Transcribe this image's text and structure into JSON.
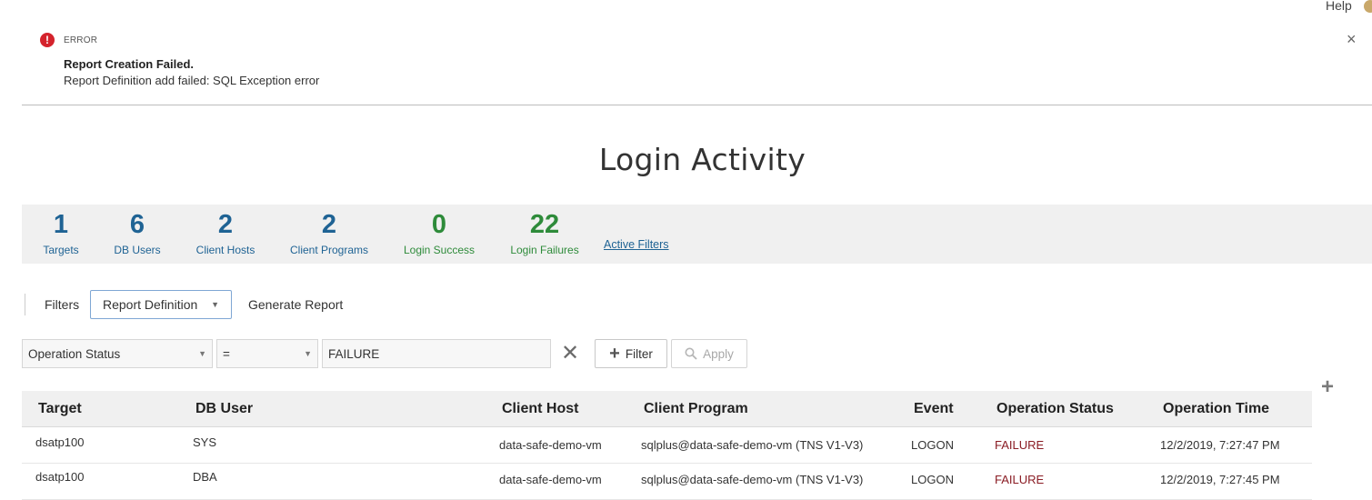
{
  "header": {
    "help_label": "Help"
  },
  "error": {
    "icon": "!",
    "label": "ERROR",
    "title": "Report Creation Failed.",
    "message": "Report Definition add failed: SQL Exception error",
    "close_glyph": "×"
  },
  "page_title": "Login Activity",
  "summary": [
    {
      "value": "1",
      "label": "Targets",
      "color": "blue"
    },
    {
      "value": "6",
      "label": "DB Users",
      "color": "blue"
    },
    {
      "value": "2",
      "label": "Client Hosts",
      "color": "blue"
    },
    {
      "value": "2",
      "label": "Client Programs",
      "color": "blue"
    },
    {
      "value": "0",
      "label": "Login Success",
      "color": "green"
    },
    {
      "value": "22",
      "label": "Login Failures",
      "color": "green"
    }
  ],
  "active_filters_label": "Active Filters",
  "toolbar": {
    "filters_label": "Filters",
    "report_definition_label": "Report Definition",
    "generate_report_label": "Generate Report"
  },
  "filter_row": {
    "field": "Operation Status",
    "operator": "=",
    "value": "FAILURE",
    "add_filter_label": "Filter",
    "apply_label": "Apply"
  },
  "table": {
    "columns": [
      "Target",
      "DB User",
      "Client Host",
      "Client Program",
      "Event",
      "Operation Status",
      "Operation Time"
    ],
    "rows": [
      {
        "target": "dsatp100",
        "db_user": "SYS",
        "client_host": "data-safe-demo-vm",
        "client_program": "sqlplus@data-safe-demo-vm (TNS V1-V3)",
        "event": "LOGON",
        "operation_status": "FAILURE",
        "operation_time": "12/2/2019, 7:27:47 PM"
      },
      {
        "target": "dsatp100",
        "db_user": "DBA",
        "client_host": "data-safe-demo-vm",
        "client_program": "sqlplus@data-safe-demo-vm (TNS V1-V3)",
        "event": "LOGON",
        "operation_status": "FAILURE",
        "operation_time": "12/2/2019, 7:27:45 PM"
      }
    ]
  },
  "colors": {
    "blue": "#1f6394",
    "green": "#2e8b3a",
    "error_red": "#d4232c",
    "failure_text": "#8a1c24"
  },
  "icons": {
    "error": "error-icon",
    "close": "close-icon",
    "dropdown": "chevron-down-icon",
    "clear": "clear-icon",
    "add": "plus-icon",
    "search": "search-icon",
    "add_column": "add-column-icon"
  }
}
